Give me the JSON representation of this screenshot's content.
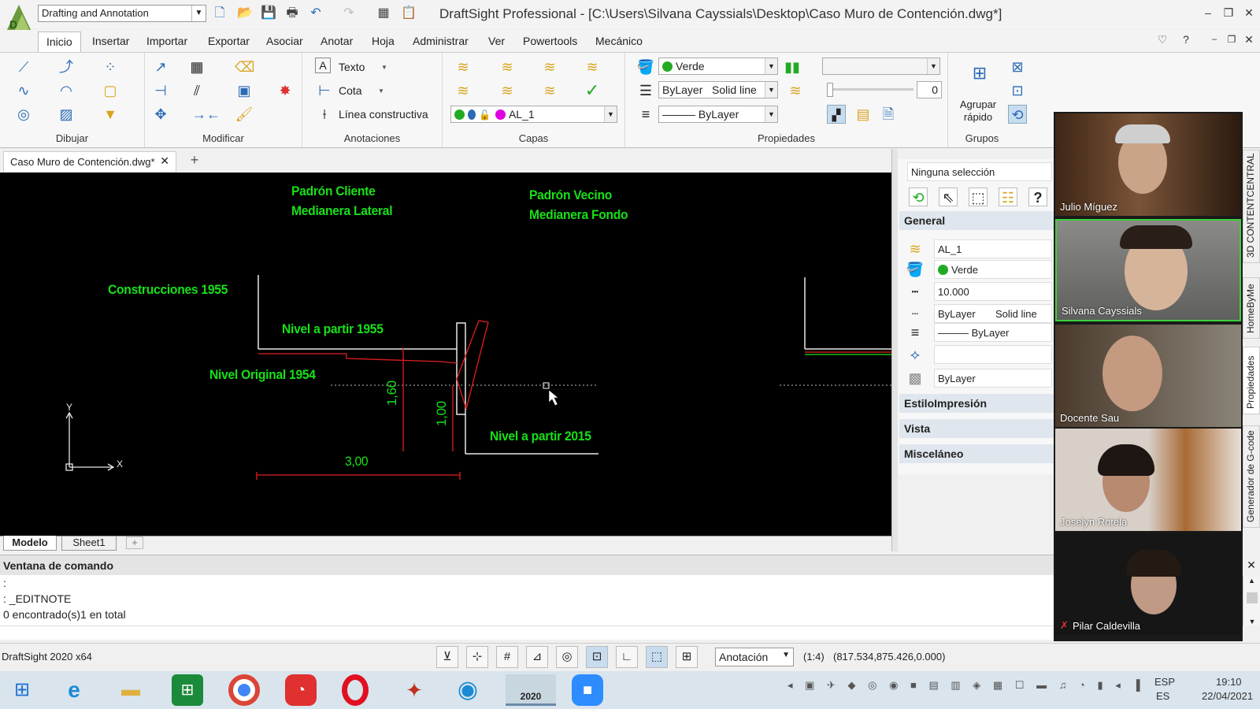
{
  "window": {
    "title": "DraftSight Professional - [C:\\Users\\Silvana Cayssials\\Desktop\\Caso Muro de Contención.dwg*]",
    "workspace": "Drafting and Annotation"
  },
  "menu": [
    "Inicio",
    "Insertar",
    "Importar",
    "Exportar",
    "Asociar",
    "Anotar",
    "Hoja",
    "Administrar",
    "Ver",
    "Powertools",
    "Mecánico"
  ],
  "ribbon": {
    "groups": {
      "dibujar": "Dibujar",
      "modificar": "Modificar",
      "anotaciones": "Anotaciones",
      "capas": "Capas",
      "propiedades": "Propiedades",
      "grupos": "Grupos"
    },
    "texto": "Texto",
    "cota": "Cota",
    "linea_constructiva": "Línea constructiva",
    "layer": "AL_1",
    "color": "Verde",
    "linetype_a": "ByLayer",
    "linetype_b": "Solid line",
    "lineweight": "——— ByLayer",
    "transparency": "0",
    "agrupar": "Agrupar rápido",
    "colors": {
      "green": "#22aa22",
      "magenta": "#e000e0",
      "blue": "#2a6bb5"
    }
  },
  "doc_tab": "Caso Muro de Contención.dwg*",
  "drawing": {
    "labels": [
      "Padrón Cliente",
      "Medianera Lateral",
      "Padrón Vecino",
      "Medianera Fondo",
      "Construcciones  1955",
      "Nivel a partir  1955",
      "Nivel Original  1954",
      "Nivel a partir  2015"
    ],
    "dims": [
      "1,60",
      "1,00",
      "3,00"
    ],
    "ucs_x": "X",
    "ucs_y": "Y"
  },
  "layout_tabs": [
    "Modelo",
    "Sheet1"
  ],
  "properties": {
    "selection": "Ninguna selección",
    "general": "General",
    "layer": "AL_1",
    "color": "Verde",
    "scale": "10.000",
    "linetype": "ByLayer",
    "linestyle": "Solid line",
    "lineweight": "——— ByLayer",
    "transparency": "ByLayer",
    "sections": [
      "EstiloImpresión",
      "Vista",
      "Misceláneo"
    ]
  },
  "command": {
    "title": "Ventana de comando",
    "lines": [
      ":",
      ": _EDITNOTE",
      "0 encontrado(s)1 en total"
    ]
  },
  "status": {
    "version": "DraftSight 2020 x64",
    "annotation": "Anotación",
    "scale": "(1:4)",
    "coords": "(817.534,875.426,0.000)"
  },
  "video": {
    "participants": [
      "Julio Míguez",
      "Silvana Cayssials",
      "Docente Sau",
      "Joselyn Rotela",
      "Pilar Caldevilla"
    ]
  },
  "side_tabs": [
    "3D CONTENTCENTRAL",
    "HomeByMe",
    "Propiedades",
    "Generador de G-code"
  ],
  "taskbar": {
    "lang_a": "ESP",
    "lang_b": "ES",
    "time": "19:10",
    "date": "22/04/2021",
    "year_badge": "2020"
  }
}
